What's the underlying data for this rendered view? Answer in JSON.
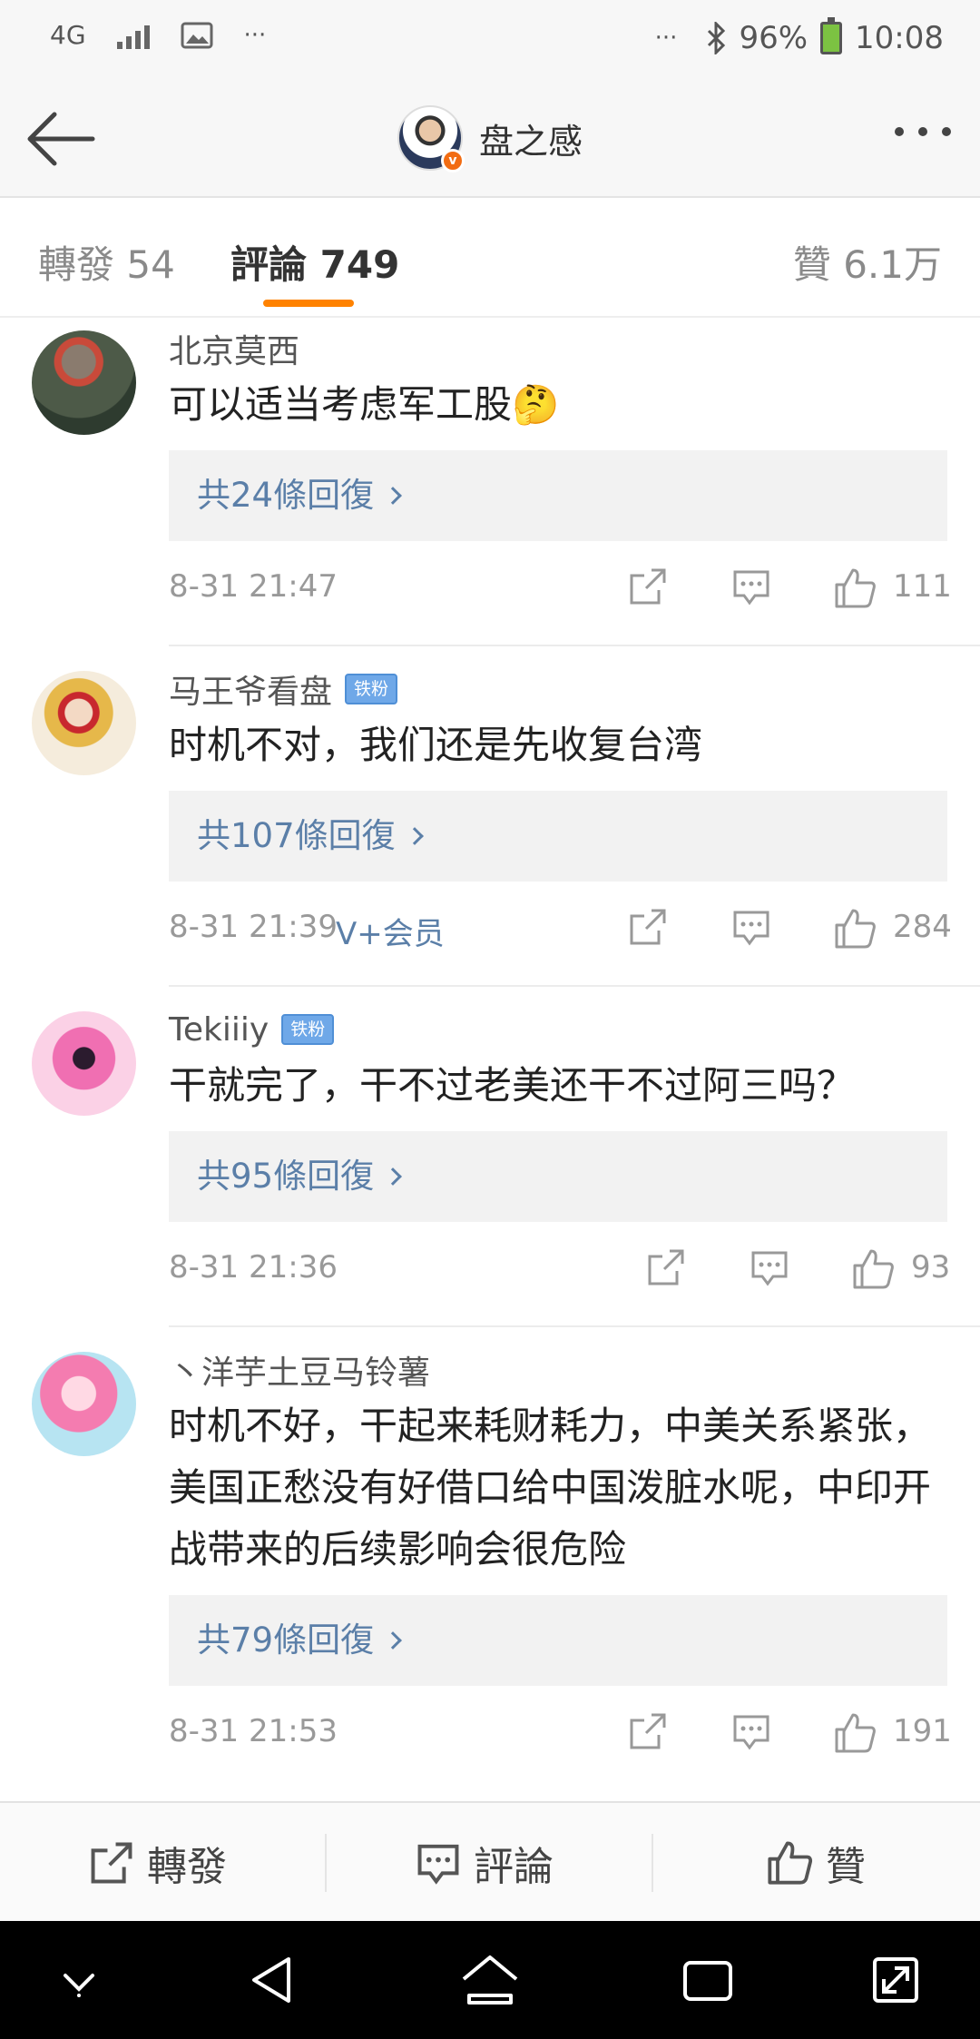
{
  "status_bar": {
    "network": "4G",
    "dots": "···",
    "battery": "96%",
    "time": "10:08"
  },
  "header": {
    "title": "盘之感"
  },
  "tabs": {
    "repost": "轉發 54",
    "comments": "評論 749",
    "likes": "贊 6.1万"
  },
  "comments": [
    {
      "name": "北京莫西",
      "badge": "",
      "text": "可以适当考虑军工股🤔",
      "replies": "共24條回復",
      "time": "8-31 21:47",
      "vip": "",
      "likes": "111"
    },
    {
      "name": "马王爷看盘",
      "badge": "铁粉",
      "text": "时机不对，我们还是先收复台湾",
      "replies": "共107條回復",
      "time": "8-31 21:39",
      "vip": "V+会员",
      "likes": "284"
    },
    {
      "name": "Tekiiiy",
      "badge": "铁粉",
      "text": "干就完了，干不过老美还干不过阿三吗？",
      "replies": "共95條回復",
      "time": "8-31 21:36",
      "vip": "",
      "likes": "93"
    },
    {
      "name": "丶洋芋土豆马铃薯",
      "badge": "",
      "text": "时机不好，干起来耗财耗力，中美关系紧张，美国正愁没有好借口给中国泼脏水呢，中印开战带来的后续影响会很危险",
      "replies": "共79條回復",
      "time": "8-31 21:53",
      "vip": "",
      "likes": "191"
    }
  ],
  "bottom_bar": {
    "repost": "轉發",
    "comment": "評論",
    "like": "贊"
  },
  "colors": {
    "accent": "#ff8200",
    "link": "#5b7fa8",
    "fan_badge": "#6fa8e8"
  }
}
